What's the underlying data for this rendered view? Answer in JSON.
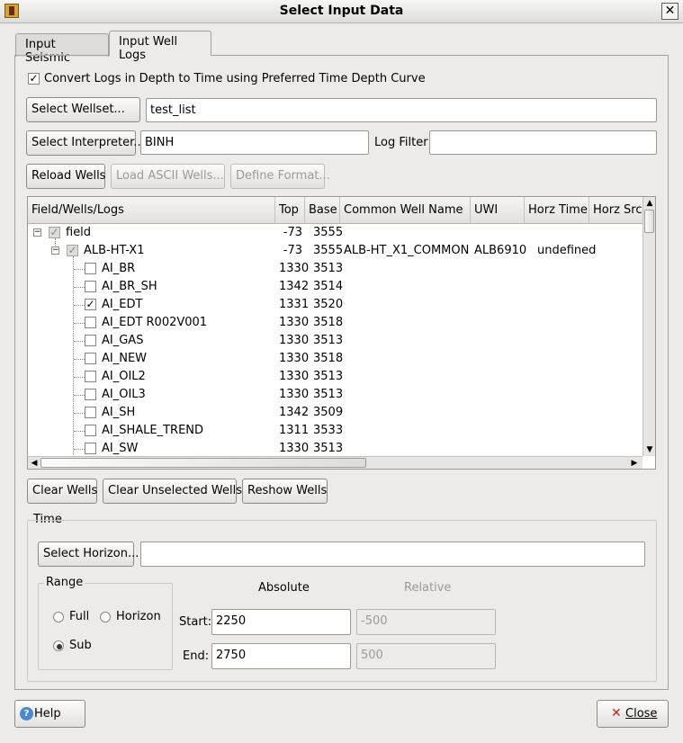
{
  "window": {
    "title": "Select Input Data",
    "close_glyph": "✕"
  },
  "tabs": [
    {
      "label": "Input Seismic"
    },
    {
      "label": "Input Well Logs"
    }
  ],
  "convert_checkbox": {
    "label": "Convert Logs in Depth to Time using Preferred Time Depth Curve",
    "checked": true
  },
  "wellset": {
    "button": "Select Wellset...",
    "value": "test_list"
  },
  "interpreter": {
    "button": "Select Interpreter...",
    "value": "BINH",
    "filter_label": "Log Filter",
    "filter_value": ""
  },
  "actions": {
    "reload": "Reload Wells",
    "load_ascii": "Load ASCII Wells...",
    "define_format": "Define Format..."
  },
  "tree": {
    "columns": [
      "Field/Wells/Logs",
      "Top",
      "Base",
      "Common Well Name",
      "UWI",
      "Horz Time",
      "Horz Src"
    ],
    "field": {
      "name": "field",
      "top": "-73",
      "base": "3555"
    },
    "well": {
      "name": "ALB-HT-X1",
      "top": "-73",
      "base": "3555",
      "common_name": "ALB-HT_X1_COMMON",
      "uwi": "ALB6910",
      "horz_time": "undefined"
    },
    "logs": [
      {
        "name": "AI_BR",
        "top": "1330",
        "base": "3513",
        "checked": false
      },
      {
        "name": "AI_BR_SH",
        "top": "1342",
        "base": "3514",
        "checked": false
      },
      {
        "name": "AI_EDT",
        "top": "1331",
        "base": "3520",
        "checked": true
      },
      {
        "name": "AI_EDT R002V001",
        "top": "1330",
        "base": "3518",
        "checked": false
      },
      {
        "name": "AI_GAS",
        "top": "1330",
        "base": "3513",
        "checked": false
      },
      {
        "name": "AI_NEW",
        "top": "1330",
        "base": "3518",
        "checked": false
      },
      {
        "name": "AI_OIL2",
        "top": "1330",
        "base": "3513",
        "checked": false
      },
      {
        "name": "AI_OIL3",
        "top": "1330",
        "base": "3513",
        "checked": false
      },
      {
        "name": "AI_SH",
        "top": "1342",
        "base": "3509",
        "checked": false
      },
      {
        "name": "AI_SHALE_TREND",
        "top": "1311",
        "base": "3533",
        "checked": false
      },
      {
        "name": "AI_SW",
        "top": "1330",
        "base": "3513",
        "checked": false
      }
    ]
  },
  "well_buttons": {
    "clear": "Clear Wells",
    "clear_unselected": "Clear Unselected Wells",
    "reshow": "Reshow Wells"
  },
  "time": {
    "group_label": "Time",
    "select_horizon": "Select Horizon...",
    "horizon_value": "",
    "range": {
      "label": "Range",
      "full": "Full",
      "horizon": "Horizon",
      "sub": "Sub",
      "selected": "Sub"
    },
    "absolute_label": "Absolute",
    "relative_label": "Relative",
    "start_label": "Start:",
    "end_label": "End:",
    "start_abs": "2250",
    "end_abs": "2750",
    "start_rel": "-500",
    "end_rel": "500"
  },
  "footer": {
    "help": "Help",
    "close": "Close"
  },
  "colors": {
    "accent_close": "#cc2020",
    "help_icon": "#4a88cf",
    "window_bg": "#ecebea"
  }
}
